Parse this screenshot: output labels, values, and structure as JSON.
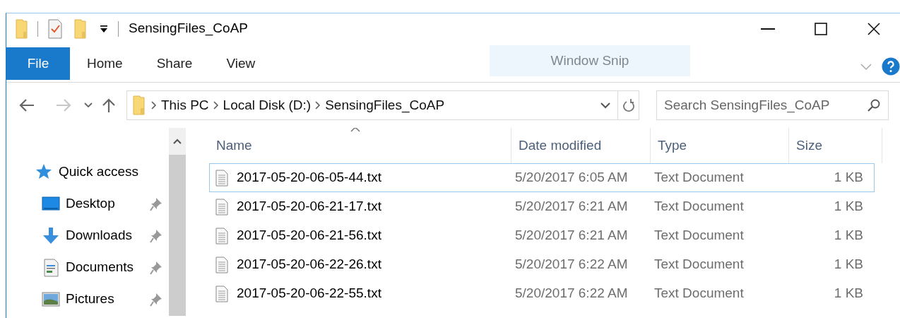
{
  "window": {
    "title": "SensingFiles_CoAP",
    "overlay_label": "Window Snip"
  },
  "ribbon_tabs": [
    {
      "label": "File",
      "selected": true
    },
    {
      "label": "Home",
      "selected": false
    },
    {
      "label": "Share",
      "selected": false
    },
    {
      "label": "View",
      "selected": false
    }
  ],
  "navigation": {
    "back_disabled": false,
    "forward_disabled": true
  },
  "address_bar": {
    "crumbs": [
      "This PC",
      "Local Disk (D:)",
      "SensingFiles_CoAP"
    ]
  },
  "search": {
    "placeholder": "Search SensingFiles_CoAP"
  },
  "nav_pane": {
    "items": [
      {
        "label": "Quick access",
        "kind": "star",
        "pinned": false
      },
      {
        "label": "Desktop",
        "kind": "desktop",
        "pinned": true
      },
      {
        "label": "Downloads",
        "kind": "download",
        "pinned": true
      },
      {
        "label": "Documents",
        "kind": "document",
        "pinned": true
      },
      {
        "label": "Pictures",
        "kind": "pictures",
        "pinned": true
      }
    ]
  },
  "table": {
    "columns": [
      {
        "label": "Name",
        "sorted": true
      },
      {
        "label": "Date modified",
        "sorted": false
      },
      {
        "label": "Type",
        "sorted": false
      },
      {
        "label": "Size",
        "sorted": false
      }
    ],
    "rows": [
      {
        "cells": [
          "2017-05-20-06-05-44.txt",
          "5/20/2017 6:05 AM",
          "Text Document",
          "1 KB"
        ],
        "focused": true
      },
      {
        "cells": [
          "2017-05-20-06-21-17.txt",
          "5/20/2017 6:21 AM",
          "Text Document",
          "1 KB"
        ],
        "focused": false
      },
      {
        "cells": [
          "2017-05-20-06-21-56.txt",
          "5/20/2017 6:21 AM",
          "Text Document",
          "1 KB"
        ],
        "focused": false
      },
      {
        "cells": [
          "2017-05-20-06-22-26.txt",
          "5/20/2017 6:22 AM",
          "Text Document",
          "1 KB"
        ],
        "focused": false
      },
      {
        "cells": [
          "2017-05-20-06-22-55.txt",
          "5/20/2017 6:22 AM",
          "Text Document",
          "1 KB"
        ],
        "focused": false
      }
    ]
  }
}
